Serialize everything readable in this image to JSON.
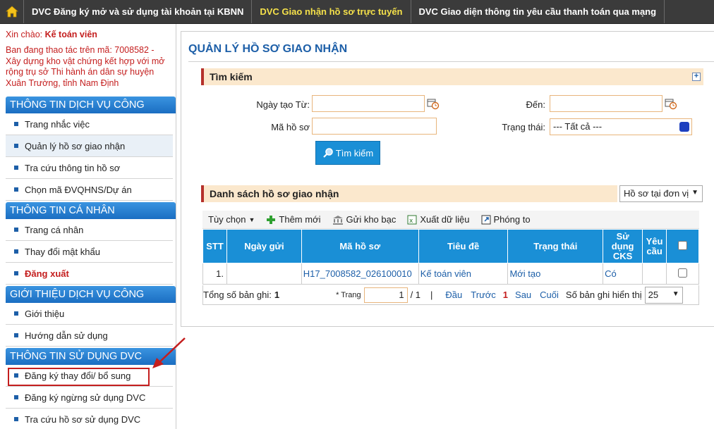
{
  "topbar": {
    "tabs": [
      {
        "label": "DVC Đăng ký mở và sử dụng tài khoản tại KBNN"
      },
      {
        "label": "DVC Giao nhận hồ sơ trực tuyến"
      },
      {
        "label": "DVC Giao diện thông tin yêu cầu thanh toán qua mạng"
      }
    ],
    "active_tab": 1,
    "active_color": "#f5e14a"
  },
  "sidebar": {
    "greeting_prefix": "Xin chào:",
    "user_role": "Kế toán viên",
    "org_text": "Ban đang thao tác trên mã: 7008582 - Xây dựng kho vật chứng kết hợp với mở rộng trụ sở Thi hành án dân sự huyện Xuân Trường, tỉnh Nam Định",
    "sections": [
      {
        "title": "THÔNG TIN DỊCH VỤ CÔNG",
        "items": [
          "Trang nhắc việc",
          "Quản lý hồ sơ giao nhận",
          "Tra cứu thông tin hồ sơ",
          "Chọn mã ĐVQHNS/Dự án"
        ]
      },
      {
        "title": "THÔNG TIN CÁ NHÂN",
        "items": [
          "Trang cá nhân",
          "Thay đổi mật khẩu",
          "Đăng xuất"
        ]
      },
      {
        "title": "GIỚI THIỆU DỊCH VỤ CÔNG",
        "items": [
          "Giới thiệu",
          "Hướng dẫn sử dụng"
        ]
      },
      {
        "title": "THÔNG TIN SỬ DỤNG DVC",
        "items": [
          "Đăng ký thay đổi/ bổ sung",
          "Đăng ký ngừng sử dụng DVC",
          "Tra cứu hồ sơ sử dụng DVC"
        ]
      }
    ]
  },
  "main": {
    "title": "QUẢN LÝ HỒ SƠ GIAO NHẬN",
    "search": {
      "header": "Tìm kiếm",
      "expand_label": "+",
      "from_label": "Ngày tạo Từ:",
      "to_label": "Đến:",
      "code_label": "Mã hồ sơ",
      "status_label": "Trạng thái:",
      "status_value": "--- Tất cả ---",
      "from_value": "",
      "to_value": "",
      "code_value": "",
      "button_label": "Tìm kiếm"
    },
    "list": {
      "header": "Danh sách hồ sơ giao nhận",
      "filter_value": "Hồ sơ tại đơn vị",
      "toolbar": {
        "options": "Tùy chọn",
        "add": "Thêm mới",
        "send": "Gửi kho bạc",
        "export": "Xuất dữ liệu",
        "zoom": "Phóng to"
      },
      "columns": [
        "STT",
        "Ngày gửi",
        "Mã hồ sơ",
        "Tiêu đề",
        "Trạng thái",
        "Sử dụng CKS",
        "Yêu cầu",
        ""
      ],
      "rows": [
        {
          "stt": "1.",
          "date": "",
          "code": "H17_7008582_026100010",
          "title": "Kế toán viên",
          "status": "Mới tạo",
          "cks": "Có",
          "request": ""
        }
      ],
      "pager": {
        "total_label": "Tổng số bản ghi:",
        "total": "1",
        "page_label": "* Trang",
        "page_value": "1",
        "page_total": "/ 1",
        "sep": "|",
        "first": "Đầu",
        "prev": "Trước",
        "current": "1",
        "next": "Sau",
        "last": "Cuối",
        "size_label": "Số bản ghi hiển thị",
        "size_value": "25"
      }
    }
  },
  "colors": {
    "accent": "#1a8fd6",
    "title_blue": "#1d5fa8",
    "warning_red": "#c41e1e"
  }
}
